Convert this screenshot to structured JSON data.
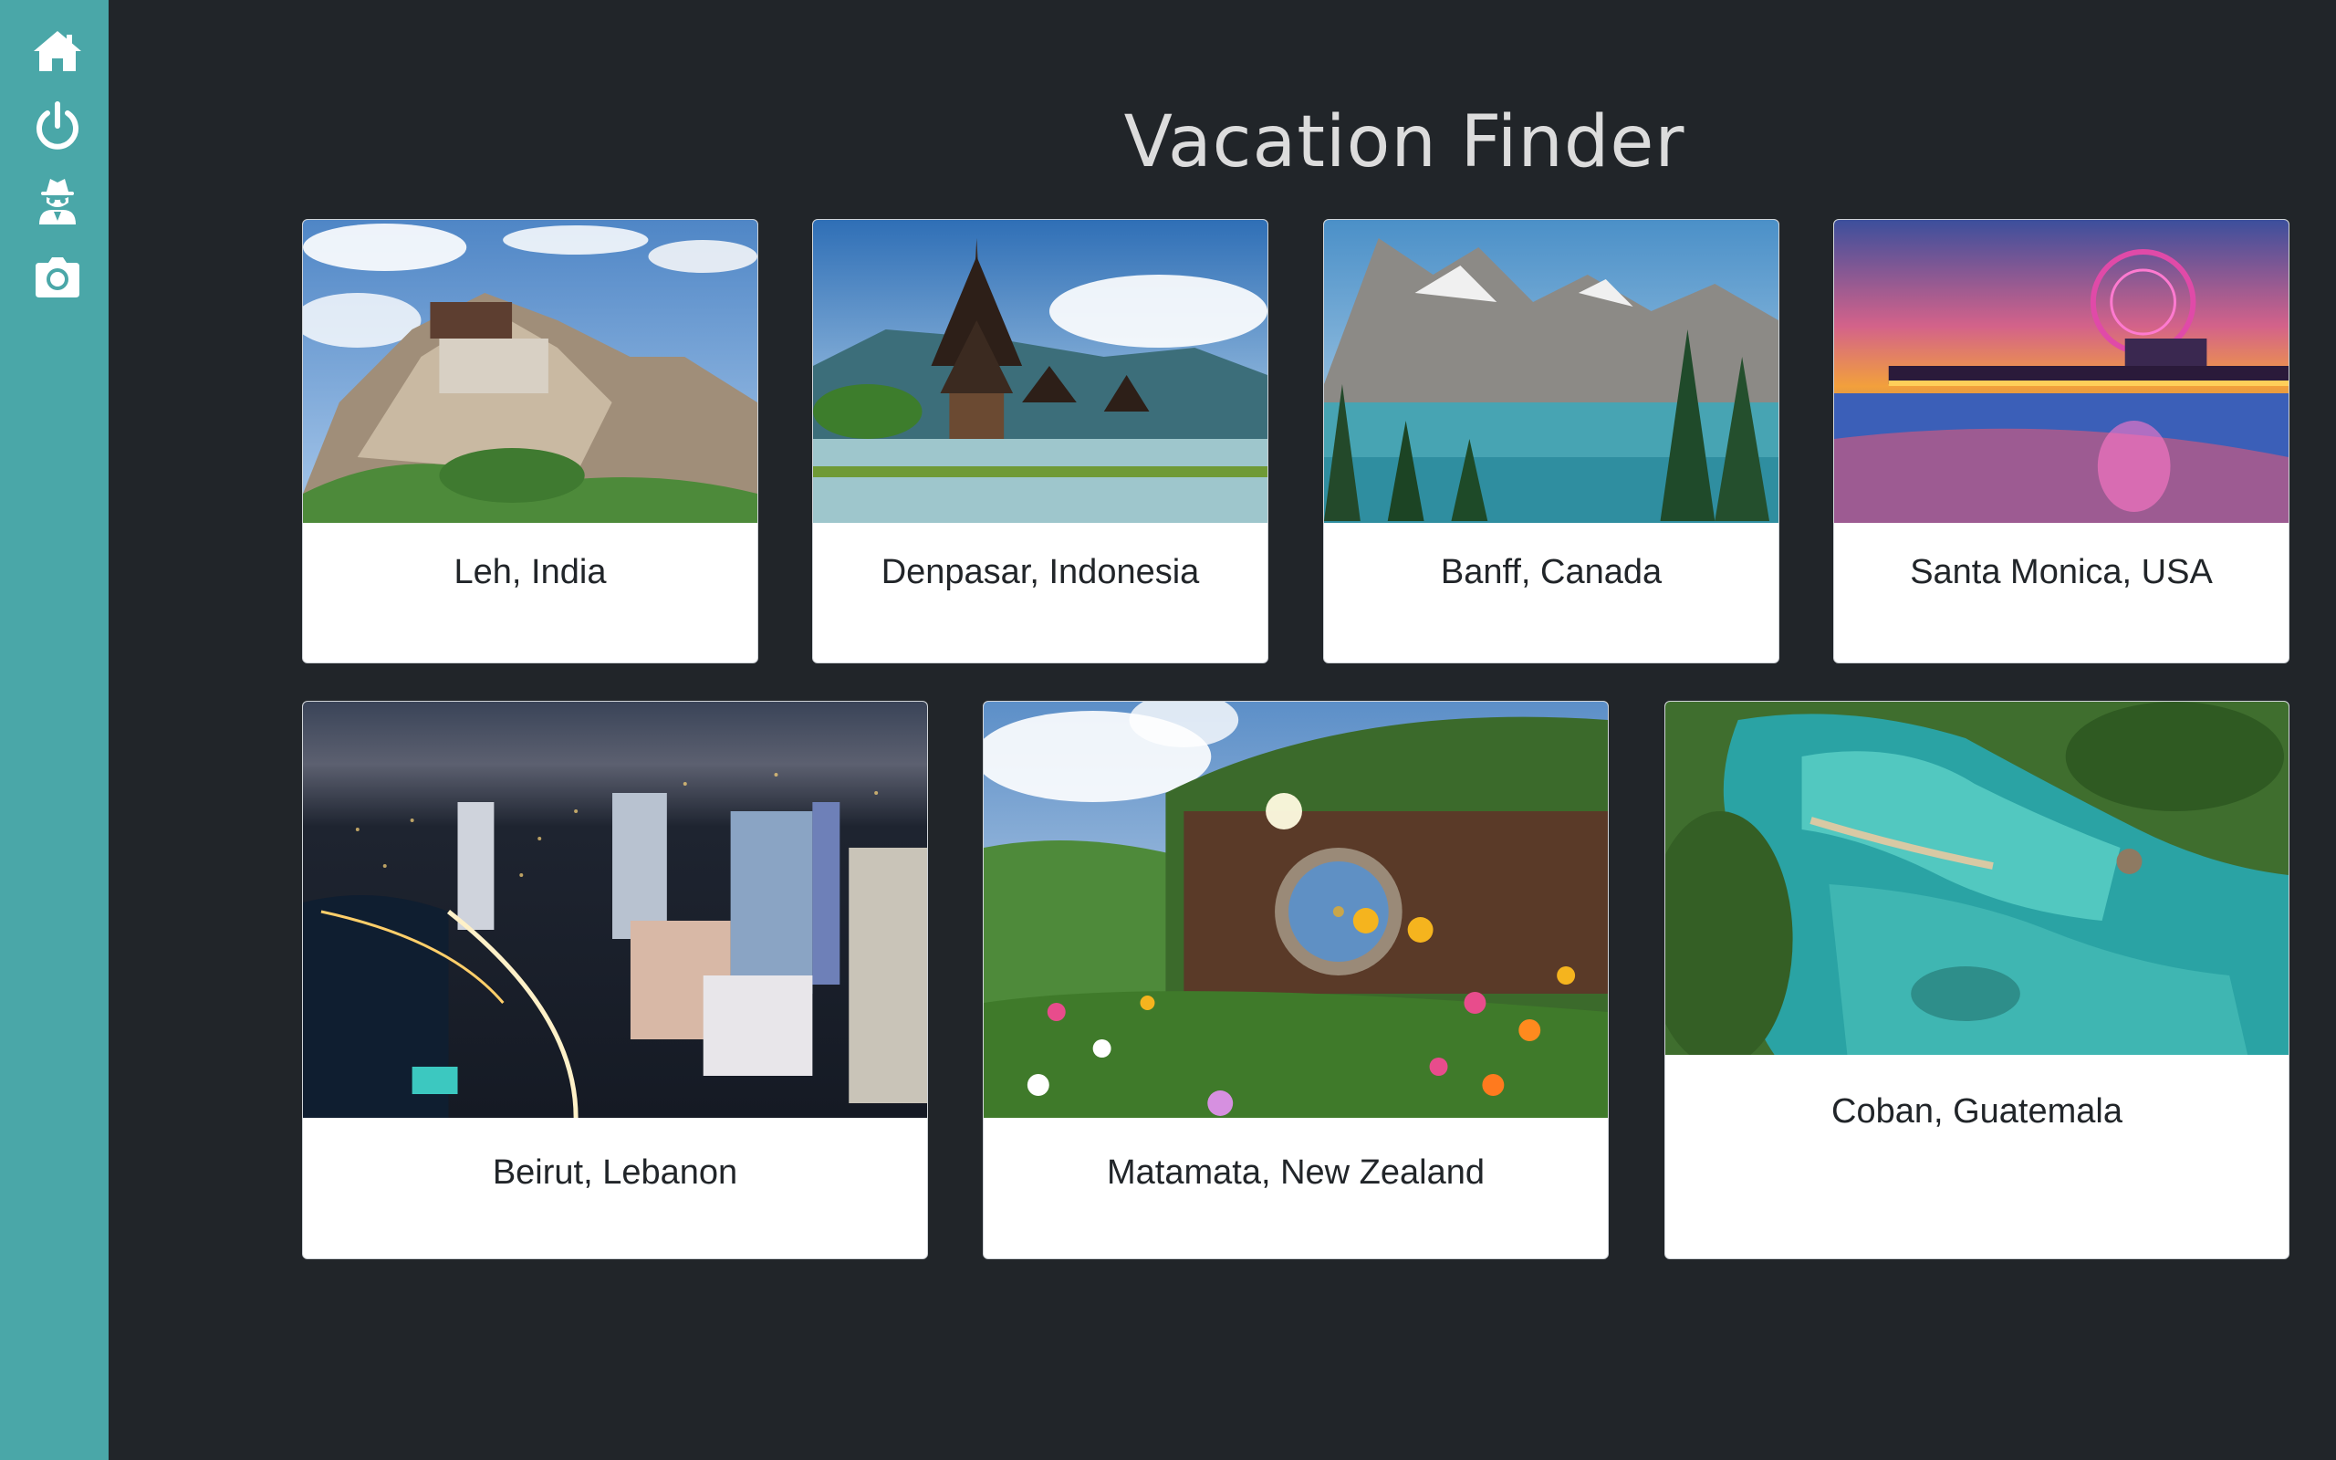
{
  "sidebar": {
    "items": [
      {
        "icon": "home-icon"
      },
      {
        "icon": "power-icon"
      },
      {
        "icon": "user-secret-icon"
      },
      {
        "icon": "camera-icon"
      }
    ],
    "background": "#4aa7a8"
  },
  "page": {
    "title": "Vacation Finder",
    "background": "#212529"
  },
  "destinations": [
    {
      "name": "Leh, India"
    },
    {
      "name": "Denpasar, Indonesia"
    },
    {
      "name": "Banff, Canada"
    },
    {
      "name": "Santa Monica, USA"
    },
    {
      "name": "Beirut, Lebanon"
    },
    {
      "name": "Matamata, New Zealand"
    },
    {
      "name": "Coban, Guatemala"
    }
  ]
}
